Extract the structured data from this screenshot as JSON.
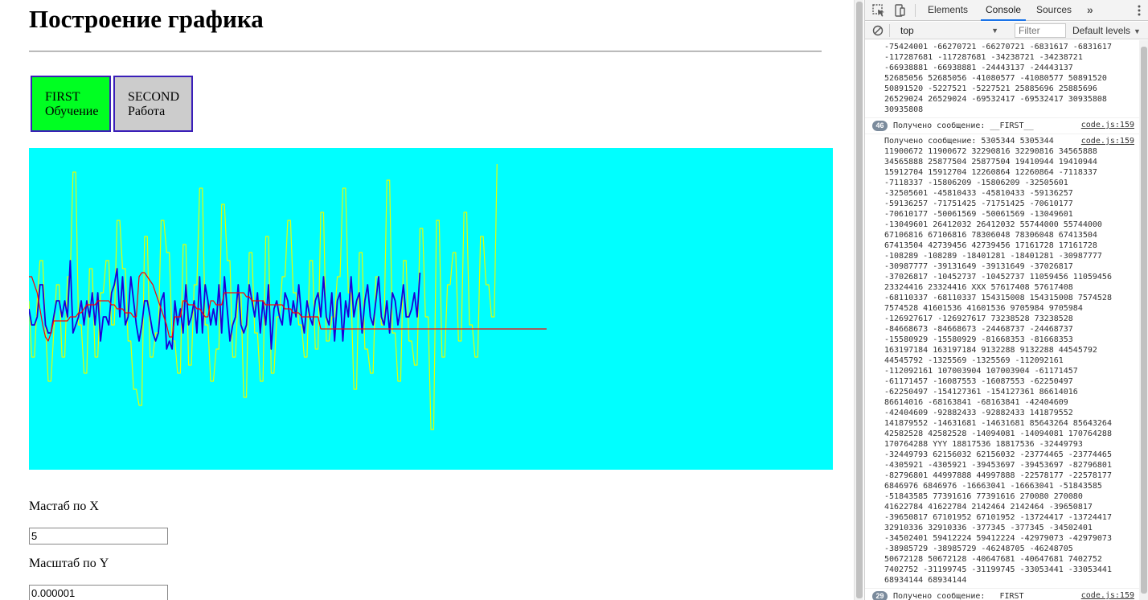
{
  "page": {
    "title": "Построение графика",
    "buttons": [
      {
        "line1": "FIRST",
        "line2": "Обучение"
      },
      {
        "line1": "SECOND",
        "line2": "Работа"
      }
    ],
    "scale_x": {
      "label": "Мастаб по X",
      "value": "5"
    },
    "scale_y": {
      "label": "Масштаб по Y",
      "value": "0.000001"
    }
  },
  "colors": {
    "chart_bg": "#00ffff",
    "first_button": "#00ff22",
    "second_button": "#cccccc",
    "series_red": "#ff0000",
    "series_yellow": "#e6ff00",
    "series_blue": "#1a00d9"
  },
  "chart_data": {
    "type": "line",
    "xlim": [
      0,
      200
    ],
    "ylim": [
      -200,
      200
    ],
    "grid": false,
    "series": [
      {
        "color": "#e6ff00",
        "values": [
          10,
          -60,
          -60,
          10,
          60,
          60,
          -20,
          -90,
          -90,
          -30,
          30,
          30,
          -60,
          -60,
          40,
          40,
          170,
          170,
          -20,
          -20,
          -80,
          -80,
          50,
          50,
          -60,
          -60,
          20,
          20,
          60,
          60,
          -20,
          -20,
          110,
          110,
          50,
          50,
          -40,
          -40,
          -100,
          -100,
          -120,
          -120,
          90,
          90,
          -60,
          -60,
          -30,
          -30,
          110,
          110,
          70,
          70,
          -40,
          -40,
          -80,
          -80,
          80,
          80,
          -70,
          -70,
          30,
          30,
          150,
          150,
          -20,
          -20,
          -90,
          -90,
          -50,
          -50,
          130,
          130,
          60,
          60,
          -60,
          -60,
          20,
          20,
          -110,
          -110,
          70,
          70,
          -30,
          -30,
          -90,
          -90,
          90,
          90,
          -80,
          -80,
          -10,
          -10,
          40,
          40,
          110,
          110,
          20,
          20,
          -20,
          -20,
          -60,
          -60,
          60,
          60,
          -50,
          -50,
          120,
          120,
          -40,
          -40,
          -10,
          -10,
          40,
          40,
          150,
          150,
          20,
          20,
          -100,
          -100,
          70,
          70,
          -50,
          -50,
          -80,
          -80,
          40,
          40,
          -20,
          -20,
          160,
          160,
          -30,
          -30,
          -90,
          -90,
          60,
          60,
          -40,
          -40,
          -70,
          -70,
          100,
          100,
          -10,
          -10,
          -150,
          -150,
          110,
          110,
          -60,
          -60,
          30,
          30,
          70,
          70,
          -40,
          -40,
          120,
          120,
          -20,
          -20,
          -60,
          -60,
          90,
          90,
          30,
          30,
          -10,
          -10,
          180
        ]
      },
      {
        "color": "#1a00d9",
        "values": [
          0,
          -20,
          -20,
          -10,
          30,
          30,
          -20,
          -30,
          -30,
          -10,
          10,
          10,
          -10,
          10,
          -10,
          60,
          -30,
          -20,
          -10,
          10,
          -20,
          10,
          -10,
          20,
          -20,
          20,
          -40,
          -10,
          -10,
          -20,
          20,
          30,
          50,
          -10,
          40,
          -20,
          -10,
          40,
          10,
          -20,
          -40,
          -20,
          10,
          10,
          -10,
          -30,
          -40,
          -30,
          10,
          20,
          -50,
          -40,
          -50,
          10,
          -20,
          0,
          -30,
          30,
          -20,
          -10,
          10,
          -30,
          40,
          -30,
          30,
          10,
          -20,
          0,
          -20,
          30,
          -30,
          40,
          0,
          -40,
          -20,
          -10,
          30,
          -20,
          -30,
          -20,
          30,
          10,
          -10,
          20,
          -30,
          10,
          -20,
          30,
          -50,
          0,
          10,
          -10,
          -20,
          20,
          10,
          -20,
          10,
          -10,
          30,
          -10,
          -30,
          10,
          -10,
          -20,
          10,
          20,
          -10,
          40,
          -10,
          -20,
          20,
          -40,
          10,
          20,
          -40,
          10,
          -10,
          40,
          -10,
          10,
          20,
          -30,
          10,
          30,
          -10,
          -20,
          10,
          40,
          -10,
          -20,
          10,
          -30,
          20,
          10,
          -20,
          0,
          30,
          -10,
          -10,
          0,
          20,
          -10,
          45
        ]
      },
      {
        "color": "#ff0000",
        "values": [
          40,
          40,
          30,
          20,
          0,
          -20,
          -35,
          -40,
          -30,
          -15,
          -15,
          -15,
          -15,
          -15,
          -15,
          -10,
          -10,
          -10,
          -5,
          -5,
          0,
          5,
          5,
          5,
          5,
          10,
          10,
          10,
          10,
          10,
          5,
          5,
          0,
          0,
          0,
          -5,
          -5,
          -5,
          -10,
          -10,
          40,
          45,
          45,
          40,
          35,
          30,
          20,
          10,
          0,
          -10,
          -20,
          -35,
          -35,
          -10,
          -10,
          -10,
          10,
          10,
          5,
          5,
          5,
          0,
          0,
          -5,
          -10,
          -10,
          10,
          10,
          5,
          5,
          5,
          20,
          20,
          20,
          20,
          20,
          20,
          20,
          20,
          15,
          15,
          10,
          10,
          10,
          10,
          10,
          5,
          5,
          5,
          5,
          5,
          5,
          5,
          0,
          0,
          0,
          -5,
          -5,
          -5,
          -10,
          -10,
          -10,
          -10,
          -10,
          -10,
          -10,
          -25,
          -25,
          -25,
          -25,
          -25,
          -25,
          -25,
          -25,
          -25,
          -25,
          -25,
          -25,
          -25,
          -25,
          -25,
          -25,
          -25,
          -25,
          -25,
          -25,
          -25,
          -25,
          -25,
          -25,
          -25,
          -25,
          -25,
          -25,
          -25,
          -25,
          -25,
          -25,
          -25,
          -25,
          -25,
          -25,
          -25,
          -25,
          -25,
          -25,
          -25,
          -25,
          -25,
          -25,
          -25,
          -25,
          -25,
          -25,
          -25,
          -25,
          -25,
          -25,
          -25,
          -25,
          -25,
          -25,
          -25,
          -25,
          -25,
          -25,
          -25,
          -25,
          -25,
          -25,
          -25,
          -25,
          -25,
          -25,
          -25,
          -25,
          -25,
          -25,
          -25,
          -25,
          -25,
          -25,
          -25,
          -25,
          -25,
          -25,
          -25,
          -25,
          -25
        ]
      }
    ]
  },
  "devtools": {
    "tabs": [
      "Elements",
      "Console",
      "Sources"
    ],
    "more": "»",
    "context": "top",
    "filter_placeholder": "Filter",
    "levels": "Default levels",
    "messages": [
      {
        "kind": "block",
        "text": "-75424001 -66270721 -66270721 -6831617 -6831617\n-117287681 -117287681 -34238721 -34238721\n-66938881 -66938881 -24443137 -24443137\n52685056 52685056 -41080577 -41080577 50891520\n50891520 -5227521 -5227521 25885696 25885696\n26529024 26529024 -69532417 -69532417 30935808\n30935808"
      },
      {
        "kind": "repeat",
        "count": "46",
        "text": "Получено сообщение: __FIRST__",
        "source": "code.js:159"
      },
      {
        "kind": "block",
        "source": "code.js:159",
        "text": "Получено сообщение: 5305344 5305344\n11900672 11900672 32290816 32290816 34565888\n34565888 25877504 25877504 19410944 19410944\n15912704 15912704 12260864 12260864 -7118337\n-7118337 -15806209 -15806209 -32505601\n-32505601 -45810433 -45810433 -59136257\n-59136257 -71751425 -71751425 -70610177\n-70610177 -50061569 -50061569 -13049601\n-13049601 26412032 26412032 55744000 55744000\n67106816 67106816 78306048 78306048 67413504\n67413504 42739456 42739456 17161728 17161728\n-108289 -108289 -18401281 -18401281 -30987777\n-30987777 -39131649 -39131649 -37026817\n-37026817 -10452737 -10452737 11059456 11059456\n23324416 23324416 XXX 57617408 57617408\n-68110337 -68110337 154315008 154315008 7574528\n7574528 41601536 41601536 9705984 9705984\n-126927617 -126927617 73238528 73238528\n-84668673 -84668673 -24468737 -24468737\n-15580929 -15580929 -81668353 -81668353\n163197184 163197184 9132288 9132288 44545792\n44545792 -1325569 -1325569 -112092161\n-112092161 107003904 107003904 -61171457\n-61171457 -16087553 -16087553 -62250497\n-62250497 -154127361 -154127361 86614016\n86614016 -68163841 -68163841 -42404609\n-42404609 -92882433 -92882433 141879552\n141879552 -14631681 -14631681 85643264 85643264\n42582528 42582528 -14094081 -14094081 170764288\n170764288 YYY 18817536 18817536 -32449793\n-32449793 62156032 62156032 -23774465 -23774465\n-4305921 -4305921 -39453697 -39453697 -82796801\n-82796801 44997888 44997888 -22578177 -22578177\n6846976 6846976 -16663041 -16663041 -51843585\n-51843585 77391616 77391616 270080 270080\n41622784 41622784 2142464 2142464 -39650817\n-39650817 67101952 67101952 -13724417 -13724417\n32910336 32910336 -377345 -377345 -34502401\n-34502401 59412224 59412224 -42979073 -42979073\n-38985729 -38985729 -46248705 -46248705\n50672128 50672128 -40647681 -40647681 7402752\n7402752 -31199745 -31199745 -33053441 -33053441\n68934144 68934144"
      },
      {
        "kind": "repeat",
        "count": "29",
        "text": "Получено сообщение: __FIRST__",
        "source": "code.js:159"
      }
    ]
  }
}
